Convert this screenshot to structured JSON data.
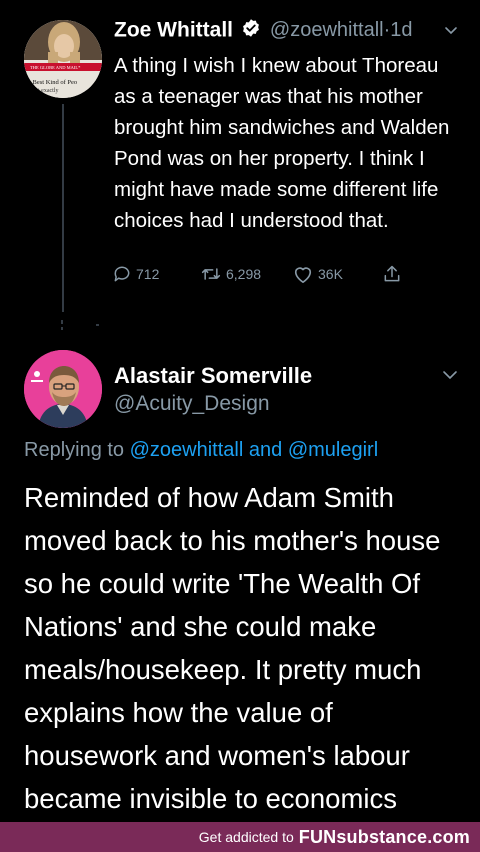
{
  "tweet1": {
    "name": "Zoe Whittall",
    "handle": "@zoewhittall",
    "separator": "·",
    "time": "1d",
    "text": "A thing I wish I knew about Thoreau as a teenager was that his mother brought him sandwiches and Walden Pond was on her property. I think I might have made some different life choices had I understood that.",
    "avatar_caption_1": "THE GLOBE AND MAIL*",
    "avatar_caption_2": "e Best Kind of Peo",
    "avatar_caption_3": "t exactly",
    "actions": {
      "replies": "712",
      "retweets": "6,298",
      "likes": "36K"
    }
  },
  "tweet2": {
    "name": "Alastair Somerville",
    "handle": "@Acuity_Design",
    "replying_prefix": "Replying to",
    "replying_mention1": "@zoewhittall",
    "replying_and": "and",
    "replying_mention2": "@mulegirl",
    "text": "Reminded of how Adam Smith moved back to his mother's house so he could write 'The Wealth Of Nations' and she could make meals/housekeep. It pretty much explains how the value of housework and women's labour became invisible to economics"
  },
  "footer": {
    "lead": "Get addicted to",
    "brand": "FUNsubstance",
    "tld": ".com"
  },
  "colors": {
    "background": "#000000",
    "secondary_text": "#8899a6",
    "link": "#1da1f2",
    "verified": "#ffffff",
    "footer_bg": "#7a2a58"
  },
  "icons": [
    "verified-badge-icon",
    "chevron-down-icon",
    "reply-icon",
    "retweet-icon",
    "like-icon",
    "share-icon"
  ]
}
